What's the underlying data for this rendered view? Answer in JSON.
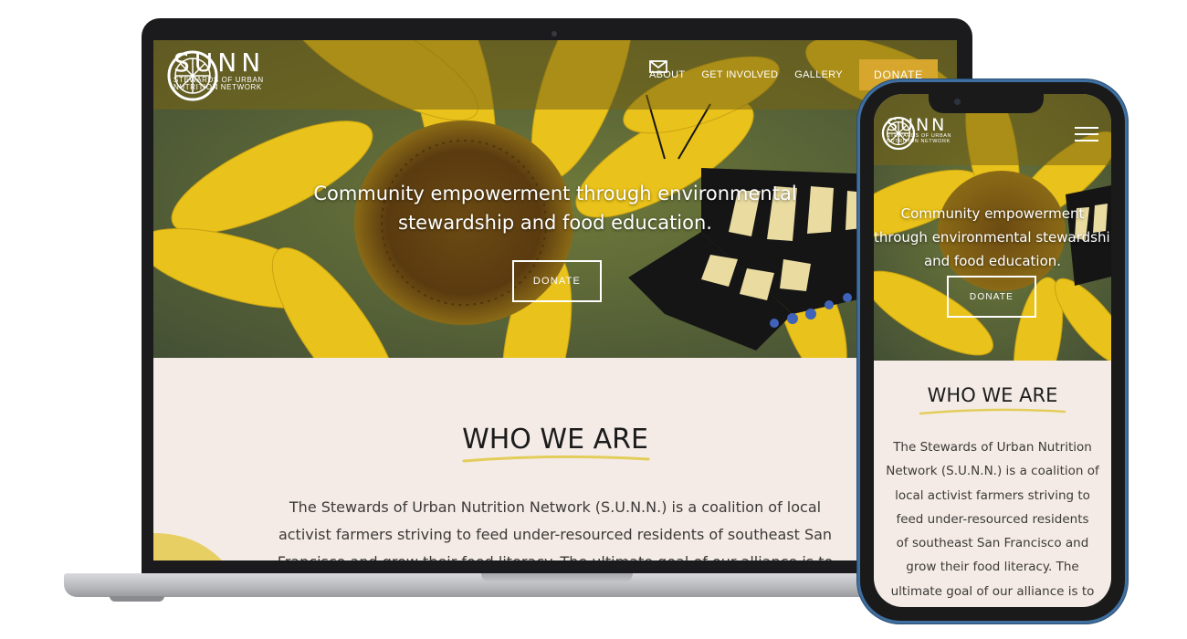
{
  "brand": {
    "name": "SUNN",
    "subtitle_line1": "STEWARDS OF URBAN",
    "subtitle_line2": "NUTRITION NETWORK"
  },
  "nav": {
    "items": [
      {
        "label": "ABOUT"
      },
      {
        "label": "GET INVOLVED"
      },
      {
        "label": "GALLERY"
      }
    ],
    "mail_icon": "mail-icon",
    "donate_label": "DONATE"
  },
  "hero": {
    "tagline_line1": "Community empowerment through environmental",
    "tagline_line2": "stewardship and food education.",
    "donate_label": "DONATE"
  },
  "about": {
    "title": "WHO WE ARE",
    "body_line1": "The Stewards of Urban Nutrition Network (S.U.N.N.) is a coalition of local",
    "body_line2": "activist farmers striving to feed under-resourced residents of southeast San",
    "body_line3": "Francisco and grow their food literacy. The ultimate goal of our alliance is to"
  },
  "mobile": {
    "tagline_line1": "Community empowerment",
    "tagline_line2": "through environmental stewardship",
    "tagline_line3": "and food education.",
    "donate_label": "DONATE",
    "about_title": "WHO WE ARE",
    "body_lines": [
      "The Stewards of Urban Nutrition",
      "Network (S.U.N.N.) is a coalition of",
      "local activist farmers striving to",
      "feed under-resourced residents",
      "of southeast San Francisco and",
      "grow their food literacy. The",
      "ultimate goal of our alliance is to"
    ]
  },
  "colors": {
    "accent_gold": "#d7a72d",
    "section_bg": "#f4ebe6",
    "underline_yellow": "#e3cd5a"
  }
}
